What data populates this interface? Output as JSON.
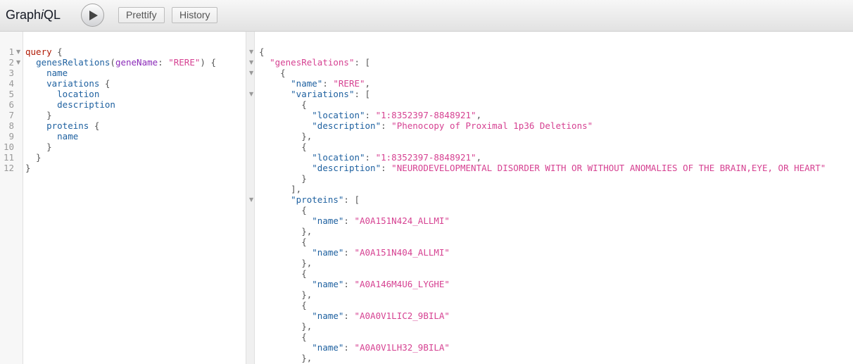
{
  "app": {
    "title_prefix": "Graph",
    "title_italic": "i",
    "title_suffix": "QL"
  },
  "toolbar": {
    "execute_icon": "play-icon",
    "prettify_label": "Prettify",
    "history_label": "History"
  },
  "query_editor": {
    "line_numbers": [
      "1",
      "2",
      "3",
      "4",
      "5",
      "6",
      "7",
      "8",
      "9",
      "10",
      "11",
      "12"
    ],
    "lines": [
      [
        {
          "t": "kw",
          "v": "query"
        },
        {
          "t": "punc",
          "v": " {"
        }
      ],
      [
        {
          "t": "punc",
          "v": "  "
        },
        {
          "t": "field",
          "v": "genesRelations"
        },
        {
          "t": "punc",
          "v": "("
        },
        {
          "t": "attr",
          "v": "geneName"
        },
        {
          "t": "punc",
          "v": ": "
        },
        {
          "t": "str",
          "v": "\"RERE\""
        },
        {
          "t": "punc",
          "v": ") {"
        }
      ],
      [
        {
          "t": "punc",
          "v": "    "
        },
        {
          "t": "field",
          "v": "name"
        }
      ],
      [
        {
          "t": "punc",
          "v": "    "
        },
        {
          "t": "field",
          "v": "variations"
        },
        {
          "t": "punc",
          "v": " {"
        }
      ],
      [
        {
          "t": "punc",
          "v": "      "
        },
        {
          "t": "field",
          "v": "location"
        }
      ],
      [
        {
          "t": "punc",
          "v": "      "
        },
        {
          "t": "field",
          "v": "description"
        }
      ],
      [
        {
          "t": "punc",
          "v": "    }"
        }
      ],
      [
        {
          "t": "punc",
          "v": "    "
        },
        {
          "t": "field",
          "v": "proteins"
        },
        {
          "t": "punc",
          "v": " {"
        }
      ],
      [
        {
          "t": "punc",
          "v": "      "
        },
        {
          "t": "field",
          "v": "name"
        }
      ],
      [
        {
          "t": "punc",
          "v": "    }"
        }
      ],
      [
        {
          "t": "punc",
          "v": "  }"
        }
      ],
      [
        {
          "t": "punc",
          "v": "}"
        }
      ]
    ],
    "fold_lines": [
      1,
      2
    ]
  },
  "result_viewer": {
    "lines": [
      [
        {
          "t": "punc",
          "v": "{"
        }
      ],
      [
        {
          "t": "punc",
          "v": "  "
        },
        {
          "t": "str",
          "v": "\"genesRelations\""
        },
        {
          "t": "punc",
          "v": ": ["
        }
      ],
      [
        {
          "t": "punc",
          "v": "    {"
        }
      ],
      [
        {
          "t": "punc",
          "v": "      "
        },
        {
          "t": "rkey",
          "v": "\"name\""
        },
        {
          "t": "punc",
          "v": ": "
        },
        {
          "t": "str",
          "v": "\"RERE\""
        },
        {
          "t": "punc",
          "v": ","
        }
      ],
      [
        {
          "t": "punc",
          "v": "      "
        },
        {
          "t": "rkey",
          "v": "\"variations\""
        },
        {
          "t": "punc",
          "v": ": ["
        }
      ],
      [
        {
          "t": "punc",
          "v": "        {"
        }
      ],
      [
        {
          "t": "punc",
          "v": "          "
        },
        {
          "t": "rkey",
          "v": "\"location\""
        },
        {
          "t": "punc",
          "v": ": "
        },
        {
          "t": "str",
          "v": "\"1:8352397-8848921\""
        },
        {
          "t": "punc",
          "v": ","
        }
      ],
      [
        {
          "t": "punc",
          "v": "          "
        },
        {
          "t": "rkey",
          "v": "\"description\""
        },
        {
          "t": "punc",
          "v": ": "
        },
        {
          "t": "str",
          "v": "\"Phenocopy of Proximal 1p36 Deletions\""
        }
      ],
      [
        {
          "t": "punc",
          "v": "        },"
        }
      ],
      [
        {
          "t": "punc",
          "v": "        {"
        }
      ],
      [
        {
          "t": "punc",
          "v": "          "
        },
        {
          "t": "rkey",
          "v": "\"location\""
        },
        {
          "t": "punc",
          "v": ": "
        },
        {
          "t": "str",
          "v": "\"1:8352397-8848921\""
        },
        {
          "t": "punc",
          "v": ","
        }
      ],
      [
        {
          "t": "punc",
          "v": "          "
        },
        {
          "t": "rkey",
          "v": "\"description\""
        },
        {
          "t": "punc",
          "v": ": "
        },
        {
          "t": "str",
          "v": "\"NEURODEVELOPMENTAL DISORDER WITH OR WITHOUT ANOMALIES OF THE BRAIN,EYE, OR HEART\""
        }
      ],
      [
        {
          "t": "punc",
          "v": "        }"
        }
      ],
      [
        {
          "t": "punc",
          "v": "      ],"
        }
      ],
      [
        {
          "t": "punc",
          "v": "      "
        },
        {
          "t": "rkey",
          "v": "\"proteins\""
        },
        {
          "t": "punc",
          "v": ": ["
        }
      ],
      [
        {
          "t": "punc",
          "v": "        {"
        }
      ],
      [
        {
          "t": "punc",
          "v": "          "
        },
        {
          "t": "rkey",
          "v": "\"name\""
        },
        {
          "t": "punc",
          "v": ": "
        },
        {
          "t": "str",
          "v": "\"A0A151N424_ALLMI\""
        }
      ],
      [
        {
          "t": "punc",
          "v": "        },"
        }
      ],
      [
        {
          "t": "punc",
          "v": "        {"
        }
      ],
      [
        {
          "t": "punc",
          "v": "          "
        },
        {
          "t": "rkey",
          "v": "\"name\""
        },
        {
          "t": "punc",
          "v": ": "
        },
        {
          "t": "str",
          "v": "\"A0A151N404_ALLMI\""
        }
      ],
      [
        {
          "t": "punc",
          "v": "        },"
        }
      ],
      [
        {
          "t": "punc",
          "v": "        {"
        }
      ],
      [
        {
          "t": "punc",
          "v": "          "
        },
        {
          "t": "rkey",
          "v": "\"name\""
        },
        {
          "t": "punc",
          "v": ": "
        },
        {
          "t": "str",
          "v": "\"A0A146M4U6_LYGHE\""
        }
      ],
      [
        {
          "t": "punc",
          "v": "        },"
        }
      ],
      [
        {
          "t": "punc",
          "v": "        {"
        }
      ],
      [
        {
          "t": "punc",
          "v": "          "
        },
        {
          "t": "rkey",
          "v": "\"name\""
        },
        {
          "t": "punc",
          "v": ": "
        },
        {
          "t": "str",
          "v": "\"A0A0V1LIC2_9BILA\""
        }
      ],
      [
        {
          "t": "punc",
          "v": "        },"
        }
      ],
      [
        {
          "t": "punc",
          "v": "        {"
        }
      ],
      [
        {
          "t": "punc",
          "v": "          "
        },
        {
          "t": "rkey",
          "v": "\"name\""
        },
        {
          "t": "punc",
          "v": ": "
        },
        {
          "t": "str",
          "v": "\"A0A0V1LH32_9BILA\""
        }
      ],
      [
        {
          "t": "punc",
          "v": "        },"
        }
      ]
    ],
    "fold_lines": [
      0,
      1,
      2,
      4,
      14
    ]
  },
  "colors": {
    "keyword": "#b11a04",
    "field": "#1f61a0",
    "argument": "#8b2bb9",
    "string": "#d64292",
    "punctuation": "#555555"
  }
}
